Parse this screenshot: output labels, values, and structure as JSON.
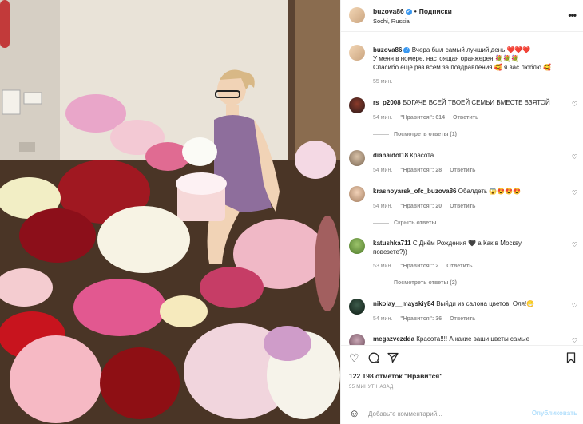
{
  "post": {
    "username": "buzova86",
    "follow_label": "Подписки",
    "location": "Sochi, Russia",
    "more_icon": "ellipsis-icon"
  },
  "caption": {
    "username": "buzova86",
    "line1": "Вчера был самый лучший день ❤️❤️❤️",
    "line2": "У меня в номере, настоящая оранжерея 💐💐💐",
    "line3": "Спасибо ещё раз всем за поздравления 🥰 я вас люблю 🥰",
    "time": "55 мин."
  },
  "comments": [
    {
      "username": "rs_p2008",
      "text": "БОГАЧЕ ВСЕЙ ТВОЕЙ СЕМЬИ ВМЕСТЕ ВЗЯТОЙ",
      "time": "54 мин.",
      "likes": "\"Нравится\": 614",
      "reply": "Ответить",
      "replies": "Посмотреть ответы (1)"
    },
    {
      "username": "dianaidol18",
      "text": "Красота",
      "time": "54 мин.",
      "likes": "\"Нравится\": 28",
      "reply": "Ответить",
      "replies": ""
    },
    {
      "username": "krasnoyarsk_ofc_buzova86",
      "text": "Обалдеть 😱😍😍😍",
      "time": "54 мин.",
      "likes": "\"Нравится\": 20",
      "reply": "Ответить",
      "replies": "Скрыть ответы"
    },
    {
      "username": "katushka711",
      "text": "С Днём Рождения 🖤 а Как в Москву повезете?))",
      "time": "53 мин.",
      "likes": "\"Нравится\": 2",
      "reply": "Ответить",
      "replies": "Посмотреть ответы (2)"
    },
    {
      "username": "nikolay__mayskiy84",
      "text": "Выйди из салона цветов. Оля!😁",
      "time": "54 мин.",
      "likes": "\"Нравится\": 36",
      "reply": "Ответить",
      "replies": ""
    },
    {
      "username": "megazvezdda",
      "text": "Красота!!!! А какие ваши цветы самые",
      "time": "",
      "likes": "",
      "reply": "",
      "replies": ""
    }
  ],
  "actions": {
    "like_icon": "heart-icon",
    "comment_icon": "comment-icon",
    "share_icon": "share-icon",
    "save_icon": "bookmark-icon"
  },
  "stats": {
    "likes": "122 198 отметок \"Нравится\"",
    "ago": "55 МИНУТ НАЗАД"
  },
  "add_comment": {
    "placeholder": "Добавьте комментарий...",
    "publish": "Опубликовать",
    "emoji_icon": "smiley-icon"
  },
  "colors": {
    "accent_blue": "#3897f0",
    "publish_disabled": "#b2dffc",
    "secondary_text": "#8e8e8e",
    "heart_red": "#ed4956"
  }
}
